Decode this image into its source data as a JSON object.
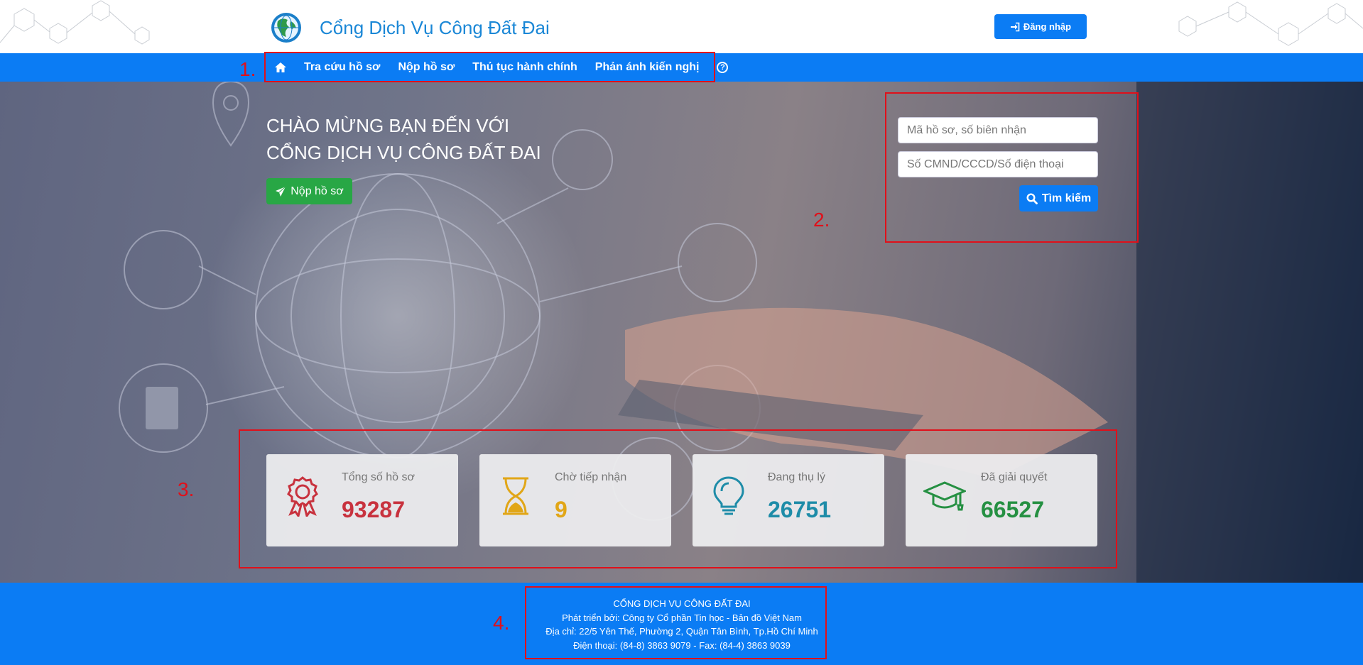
{
  "header": {
    "title": "Cổng Dịch Vụ Công Đất Đai",
    "login_label": "Đăng nhập"
  },
  "nav": {
    "items": [
      {
        "label": "Tra cứu hồ sơ"
      },
      {
        "label": "Nộp hồ sơ"
      },
      {
        "label": "Thủ tục hành chính"
      },
      {
        "label": "Phản ánh kiến nghị"
      }
    ],
    "help_glyph": "?"
  },
  "hero": {
    "welcome_line1": "CHÀO MỪNG BẠN ĐẾN VỚI",
    "welcome_line2": "CỔNG DỊCH VỤ CÔNG ĐẤT ĐAI",
    "submit_label": "Nộp hồ sơ"
  },
  "search": {
    "file_placeholder": "Mã hồ sơ, số biên nhận",
    "id_placeholder": "Số CMND/CCCD/Số điện thoại",
    "button_label": "Tìm kiếm"
  },
  "stats": [
    {
      "label": "Tổng số hồ sơ",
      "value": "93287",
      "color": "#c8323e",
      "icon": "award-icon"
    },
    {
      "label": "Chờ tiếp nhận",
      "value": "9",
      "color": "#e1a617",
      "icon": "hourglass-icon"
    },
    {
      "label": "Đang thụ lý",
      "value": "26751",
      "color": "#1e8ca8",
      "icon": "lightbulb-icon"
    },
    {
      "label": "Đã giải quyết",
      "value": "66527",
      "color": "#259042",
      "icon": "graduation-cap-icon"
    }
  ],
  "footer": {
    "line1": "CỔNG DỊCH VỤ CÔNG ĐẤT ĐAI",
    "line2": "Phát triển bởi: Công ty Cổ phần Tin học - Bản đồ Việt Nam",
    "line3": "Địa chỉ: 22/5 Yên Thế, Phường 2, Quận Tân Bình, Tp.Hồ Chí Minh",
    "line4": "Điện thoại: (84-8) 3863 9079 - Fax: (84-4) 3863 9039"
  },
  "annotations": [
    "1.",
    "2.",
    "3.",
    "4."
  ],
  "colors": {
    "brand_blue": "#0b7cf4",
    "title_blue": "#1a87d6",
    "submit_green": "#28a745",
    "annotation_red": "#e0101a"
  }
}
